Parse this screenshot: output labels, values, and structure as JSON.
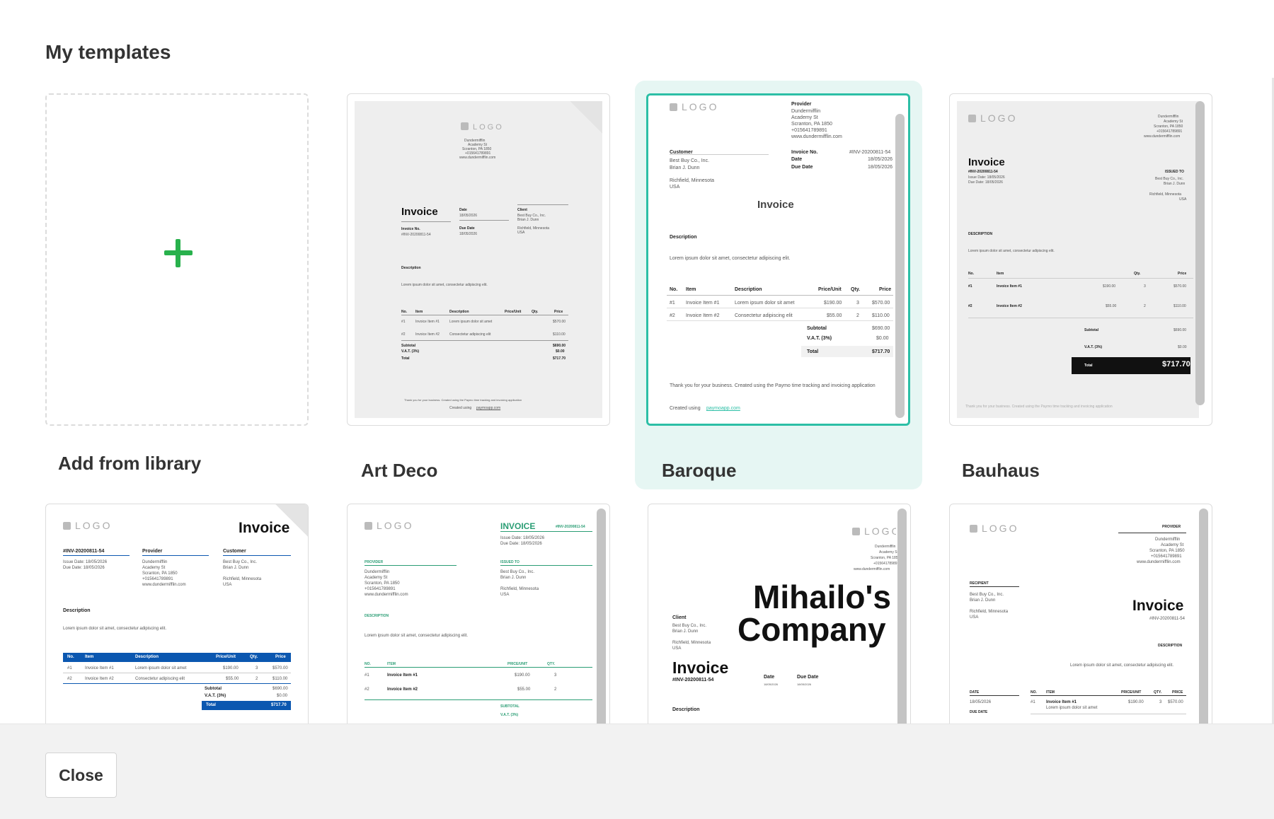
{
  "page": {
    "title": "My templates"
  },
  "footer": {
    "close_label": "Close"
  },
  "templates": [
    {
      "label": "Add from library"
    },
    {
      "label": "Art Deco"
    },
    {
      "label": "Baroque"
    },
    {
      "label": "Bauhaus"
    }
  ],
  "preview": {
    "logo": "LOGO",
    "invoice": "Invoice",
    "invoice_caps": "INVOICE",
    "invoice_no": "#INV-20200811-54",
    "provider": "Provider",
    "customer": "Customer",
    "client": "Client",
    "recipient": "RECIPIENT",
    "issued_to": "ISSUED TO",
    "description": "Description",
    "description_caps": "DESCRIPTION",
    "lorem": "Lorem ipsum dolor sit amet, consectetur adipiscing elit.",
    "company_lines": [
      "Dundermifflin",
      "Academy St",
      "Scranton, PA 1850",
      "+015641789891",
      "www.dundermifflin.com"
    ],
    "customer_lines": [
      "Best Buy Co., Inc.",
      "Brian J. Dunn",
      "Richfield, Minnesota",
      "USA"
    ],
    "invoice_no_label": "Invoice No.",
    "date_label": "Date",
    "due_date_label": "Due Date",
    "date_value": "18/05/2026",
    "issue_date": "Issue Date: 18/05/2026",
    "due_date": "Due Date: 18/05/2026",
    "table_headers": [
      "No.",
      "Item",
      "Description",
      "Price/Unit",
      "Qty.",
      "Price"
    ],
    "row1": [
      "#1",
      "Invoice Item #1",
      "Lorem ipsum dolor sit amet",
      "$190.00",
      "3",
      "$570.00"
    ],
    "row2": [
      "#2",
      "Invoice Item #2",
      "Consectetur adipiscing elit",
      "$55.00",
      "2",
      "$110.00"
    ],
    "subtotal_label": "Subtotal",
    "subtotal_value": "$690.00",
    "vat_label": "V.A.T. (3%)",
    "vat_value": "$0.00",
    "total_label": "Total",
    "total_value": "$717.70",
    "thanks": "Thank you for your business. Created using the Paymo time tracking and invoicing application",
    "created_using": "Created using",
    "paymo_link": "paymoapp.com",
    "company_name_1": "Mihailo's",
    "company_name_2": "Company"
  },
  "colors": {
    "accent": "#2cbfa6",
    "plus": "#28b14c",
    "blue": "#0b57b0",
    "green": "#2a9d74"
  }
}
